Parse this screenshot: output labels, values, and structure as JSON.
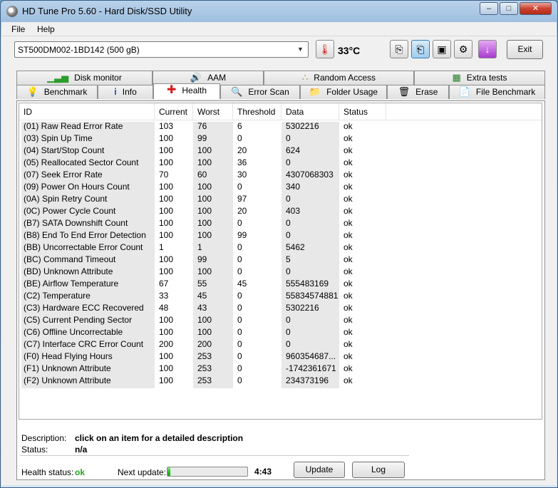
{
  "window": {
    "title": "HD Tune Pro 5.60 - Hard Disk/SSD Utility"
  },
  "menu": {
    "file": "File",
    "help": "Help"
  },
  "toolbar": {
    "drive": "ST500DM002-1BD142 (500 gB)",
    "temperature": "33°C",
    "exit": "Exit"
  },
  "tabs_top": [
    {
      "label": "Disk monitor",
      "icon": "bar-chart-icon"
    },
    {
      "label": "AAM",
      "icon": "speaker-icon"
    },
    {
      "label": "Random Access",
      "icon": "scatter-icon"
    },
    {
      "label": "Extra tests",
      "icon": "grid-icon"
    }
  ],
  "tabs_bottom": [
    {
      "label": "Benchmark",
      "icon": "lightbulb-icon"
    },
    {
      "label": "Info",
      "icon": "info-icon"
    },
    {
      "label": "Health",
      "icon": "red-cross-icon"
    },
    {
      "label": "Error Scan",
      "icon": "magnifier-icon"
    },
    {
      "label": "Folder Usage",
      "icon": "folder-icon"
    },
    {
      "label": "Erase",
      "icon": "trash-icon"
    },
    {
      "label": "File Benchmark",
      "icon": "file-icon"
    }
  ],
  "columns": [
    "ID",
    "Current",
    "Worst",
    "Threshold",
    "Data",
    "Status"
  ],
  "rows": [
    [
      "(01) Raw Read Error Rate",
      "103",
      "76",
      "6",
      "5302216",
      "ok"
    ],
    [
      "(03) Spin Up Time",
      "100",
      "99",
      "0",
      "0",
      "ok"
    ],
    [
      "(04) Start/Stop Count",
      "100",
      "100",
      "20",
      "624",
      "ok"
    ],
    [
      "(05) Reallocated Sector Count",
      "100",
      "100",
      "36",
      "0",
      "ok"
    ],
    [
      "(07) Seek Error Rate",
      "70",
      "60",
      "30",
      "4307068303",
      "ok"
    ],
    [
      "(09) Power On Hours Count",
      "100",
      "100",
      "0",
      "340",
      "ok"
    ],
    [
      "(0A) Spin Retry Count",
      "100",
      "100",
      "97",
      "0",
      "ok"
    ],
    [
      "(0C) Power Cycle Count",
      "100",
      "100",
      "20",
      "403",
      "ok"
    ],
    [
      "(B7) SATA Downshift Count",
      "100",
      "100",
      "0",
      "0",
      "ok"
    ],
    [
      "(B8) End To End Error Detection",
      "100",
      "100",
      "99",
      "0",
      "ok"
    ],
    [
      "(BB) Uncorrectable Error Count",
      "1",
      "1",
      "0",
      "5462",
      "ok"
    ],
    [
      "(BC) Command Timeout",
      "100",
      "99",
      "0",
      "5",
      "ok"
    ],
    [
      "(BD) Unknown Attribute",
      "100",
      "100",
      "0",
      "0",
      "ok"
    ],
    [
      "(BE) Airflow Temperature",
      "67",
      "55",
      "45",
      "555483169",
      "ok"
    ],
    [
      "(C2) Temperature",
      "33",
      "45",
      "0",
      "55834574881",
      "ok"
    ],
    [
      "(C3) Hardware ECC Recovered",
      "48",
      "43",
      "0",
      "5302216",
      "ok"
    ],
    [
      "(C5) Current Pending Sector",
      "100",
      "100",
      "0",
      "0",
      "ok"
    ],
    [
      "(C6) Offline Uncorrectable",
      "100",
      "100",
      "0",
      "0",
      "ok"
    ],
    [
      "(C7) Interface CRC Error Count",
      "200",
      "200",
      "0",
      "0",
      "ok"
    ],
    [
      "(F0) Head Flying Hours",
      "100",
      "253",
      "0",
      "960354687...",
      "ok"
    ],
    [
      "(F1) Unknown Attribute",
      "100",
      "253",
      "0",
      "-1742361671",
      "ok"
    ],
    [
      "(F2) Unknown Attribute",
      "100",
      "253",
      "0",
      "234373196",
      "ok"
    ]
  ],
  "details": {
    "description_label": "Description:",
    "description_value": "click on an item for a detailed description",
    "status_label": "Status:",
    "status_value": "n/a"
  },
  "footer": {
    "health_label": "Health status:",
    "health_value": "ok",
    "next_update_label": "Next update:",
    "next_update_time": "4:43",
    "progress_fraction": 0.04,
    "update_button": "Update",
    "log_button": "Log"
  }
}
